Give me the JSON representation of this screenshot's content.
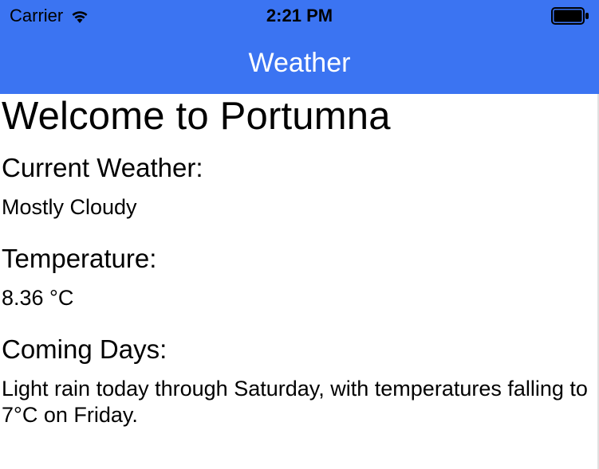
{
  "statusBar": {
    "carrier": "Carrier",
    "time": "2:21 PM"
  },
  "navBar": {
    "title": "Weather"
  },
  "content": {
    "welcome": "Welcome to Portumna",
    "currentWeatherLabel": "Current Weather:",
    "currentWeatherValue": "Mostly Cloudy",
    "temperatureLabel": "Temperature:",
    "temperatureValue": "8.36 °C",
    "comingDaysLabel": "Coming Days:",
    "comingDaysValue": "Light rain today through Saturday, with temperatures falling to 7°C on Friday."
  }
}
